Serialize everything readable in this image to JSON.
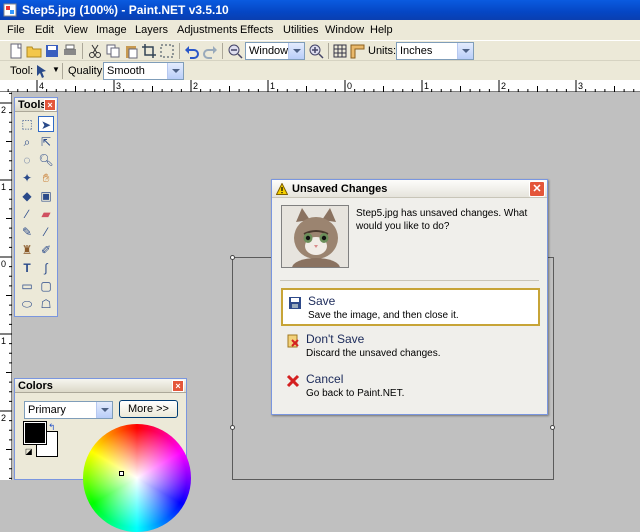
{
  "window": {
    "title": "Step5.jpg (100%) - Paint.NET v3.5.10"
  },
  "menu": [
    "File",
    "Edit",
    "View",
    "Image",
    "Layers",
    "Adjustments",
    "Effects",
    "Utilities",
    "Window",
    "Help"
  ],
  "toolbar": {
    "zoom_value": "Window",
    "units_label": "Units:",
    "units_value": "Inches",
    "tool_label": "Tool:",
    "quality_label": "Quality:",
    "quality_value": "Smooth"
  },
  "ruler_labels": [
    "4",
    "3",
    "2",
    "1",
    "0",
    "1",
    "2",
    "3"
  ],
  "vruler_labels": [
    "2",
    "1",
    "0",
    "1",
    "2"
  ],
  "tools_panel": {
    "title": "Tools"
  },
  "colors_panel": {
    "title": "Colors",
    "mode": "Primary",
    "more_button": "More >>"
  },
  "dialog": {
    "title": "Unsaved Changes",
    "message": "Step5.jpg has unsaved changes. What would you like to do?",
    "options": [
      {
        "label": "Save",
        "description": "Save the image, and then close it."
      },
      {
        "label": "Don't Save",
        "description": "Discard the unsaved changes."
      },
      {
        "label": "Cancel",
        "description": "Go back to Paint.NET."
      }
    ]
  },
  "colors": {
    "accent": "#0a5be0",
    "selection_border": "#c7a437",
    "cancel_red": "#d42020"
  }
}
